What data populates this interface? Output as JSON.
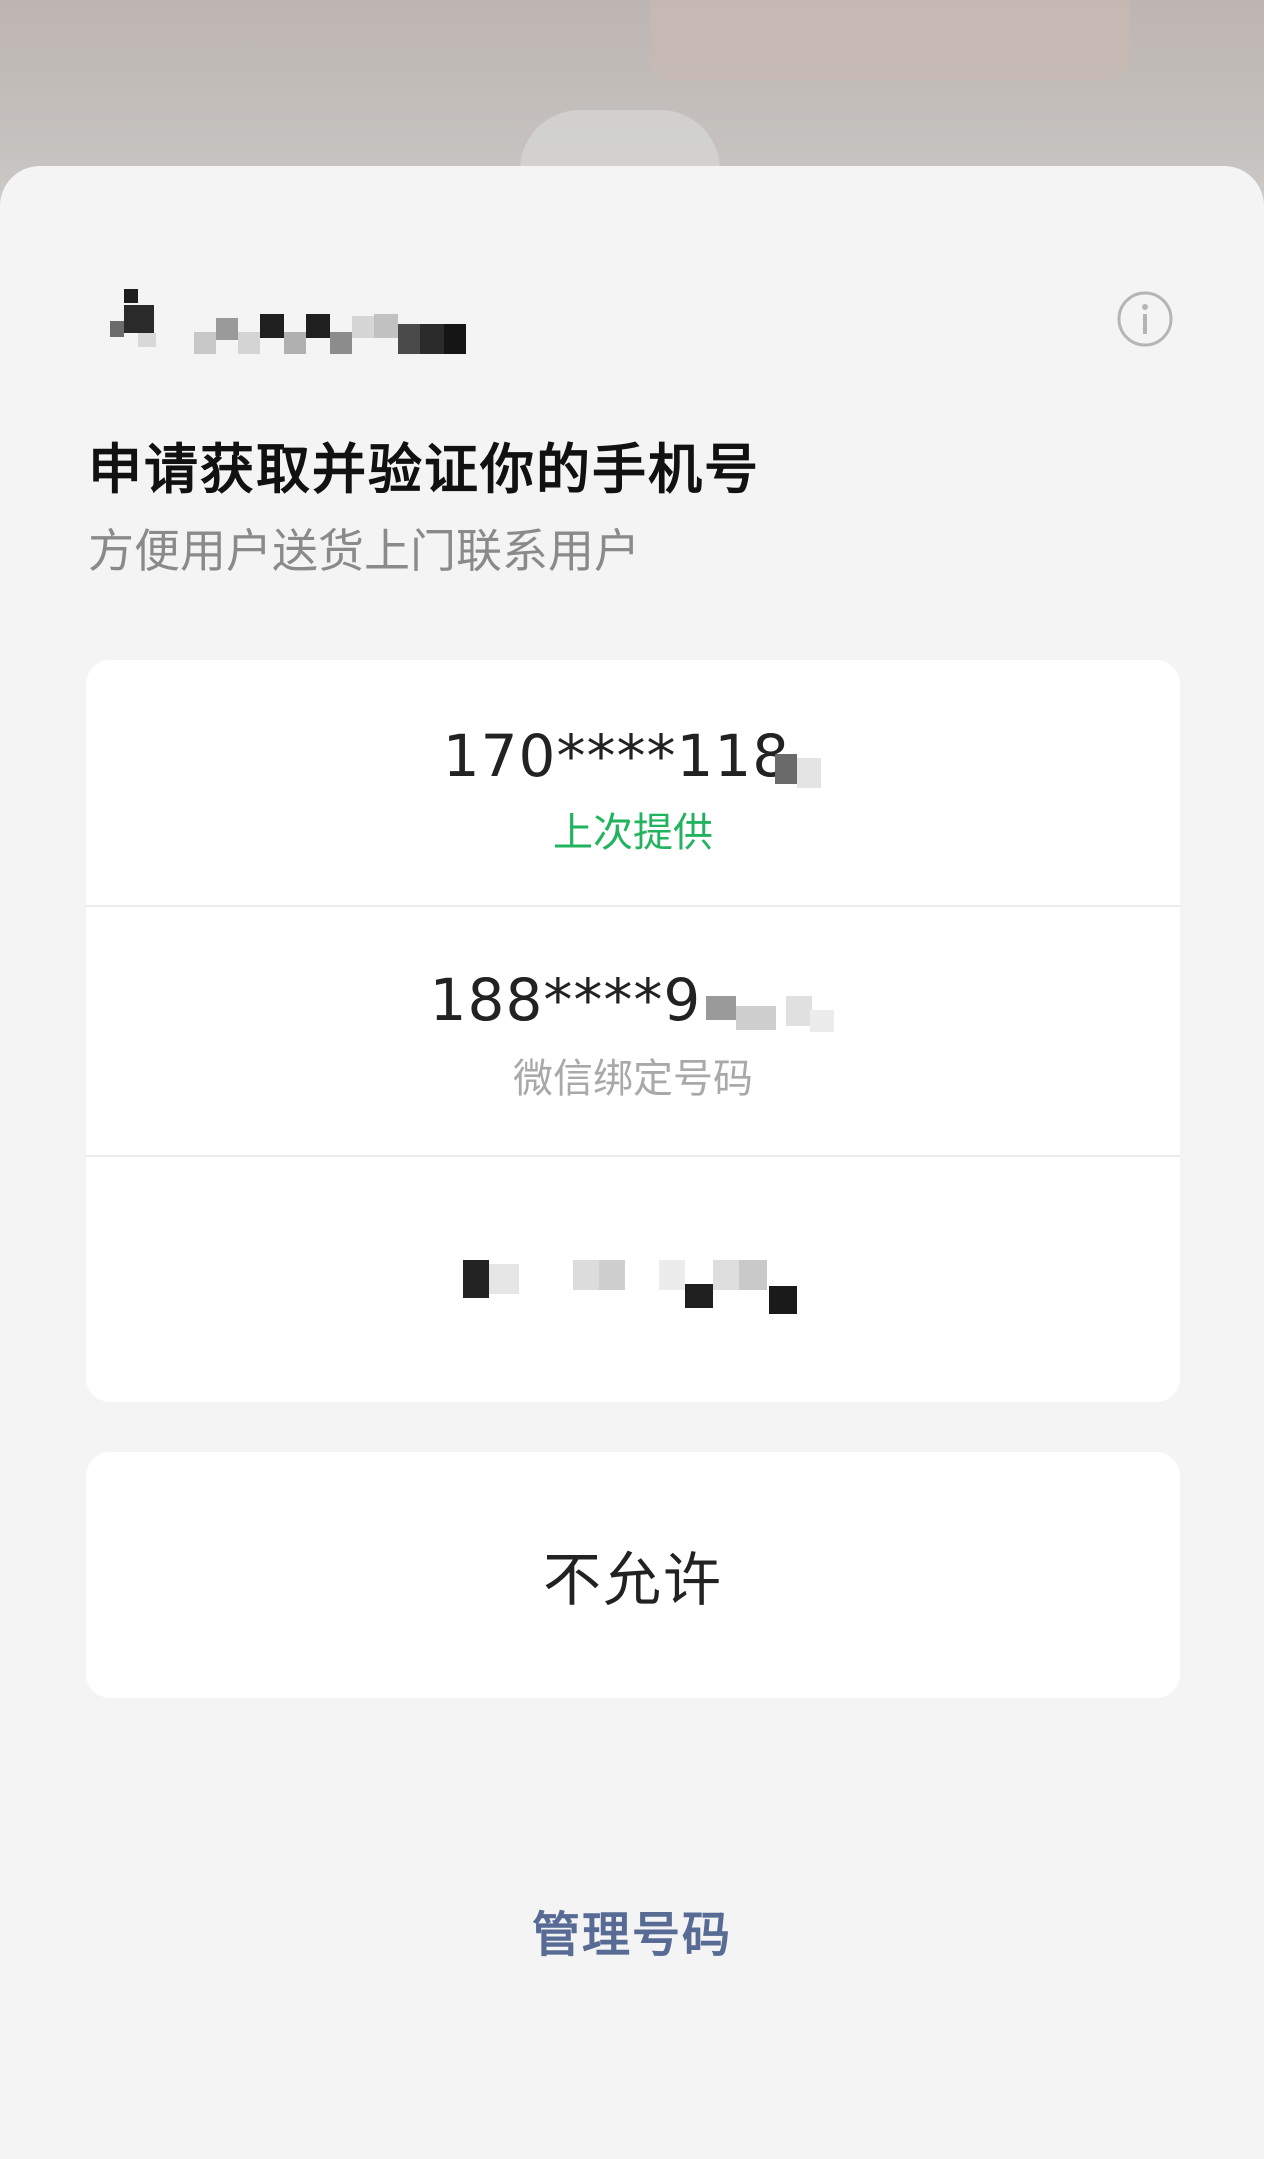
{
  "dialog": {
    "title": "申请获取并验证你的手机号",
    "subtitle": "方便用户送货上门联系用户",
    "info_icon": "info-circle-icon"
  },
  "phones": [
    {
      "number": "170****118",
      "tag": "上次提供",
      "tag_color": "#22b35e"
    },
    {
      "number": "188****9",
      "tag": "微信绑定号码",
      "tag_color": "#a9a9a9"
    },
    {
      "number": "",
      "tag": ""
    }
  ],
  "deny": {
    "label": "不允许"
  },
  "manage": {
    "label": "管理号码",
    "color": "#576b95"
  }
}
